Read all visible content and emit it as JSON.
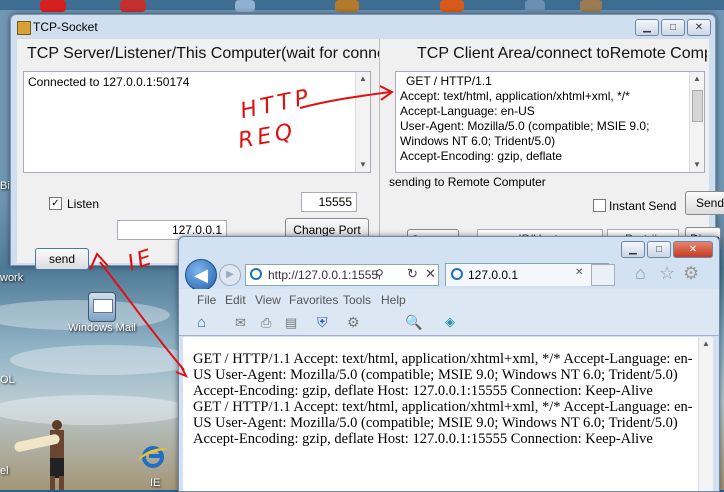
{
  "tcp_window": {
    "title": "TCP-Socket",
    "left_panel": {
      "heading": "TCP Server/Listener/This Computer(wait for connect re",
      "log_text": "Connected to 127.0.0.1:50174",
      "listen_label": "Listen",
      "listen_checked": true,
      "port_value": "15555",
      "ip_value": "127.0.0.1",
      "change_port_label": "Change Port",
      "send_label": "send"
    },
    "right_panel": {
      "heading": "TCP Client Area/connect toRemote Computer",
      "request_lines": [
        "GET / HTTP/1.1",
        "Accept: text/html, application/xhtml+xml, */*",
        "Accept-Language: en-US",
        "User-Agent: Mozilla/5.0 (compatible; MSIE 9.0;",
        "Windows NT 6.0; Trident/5.0)",
        "Accept-Encoding: gzip, deflate"
      ],
      "status_text": "sending to Remote Computer",
      "instant_send_label": "Instant Send",
      "send_partial_label": "Send",
      "connect_partial_label": "Connect",
      "ip_host_partial": "IP/Host",
      "port_partial": "Port #",
      "disconnect_partial_label": "Discon"
    }
  },
  "ie_window": {
    "address": "http://127.0.0.1:1555",
    "tab_title": "127.0.0.1",
    "menu": [
      "File",
      "Edit",
      "View",
      "Favorites",
      "Tools",
      "Help"
    ],
    "content_paragraphs": [
      "GET / HTTP/1.1 Accept: text/html, application/xhtml+xml, */* Accept-Language: en-US User-Agent: Mozilla/5.0 (compatible; MSIE 9.0; Windows NT 6.0; Trident/5.0) Accept-Encoding: gzip, deflate Host: 127.0.0.1:15555 Connection: Keep-Alive",
      "GET / HTTP/1.1 Accept: text/html, application/xhtml+xml, */* Accept-Language: en-US User-Agent: Mozilla/5.0 (compatible; MSIE 9.0; Windows NT 6.0; Trident/5.0) Accept-Encoding: gzip, deflate Host: 127.0.0.1:15555 Connection: Keep-Alive"
    ]
  },
  "desktop": {
    "icon_windows_mail": "Windows Mail",
    "icon_ie": "IE",
    "edge_labels": [
      "Bi",
      "work",
      "OL",
      "el"
    ]
  },
  "annotations": {
    "http_req_line1": "HTTP",
    "http_req_line2": "REQ",
    "ie_label": "IE"
  },
  "colors": {
    "annotation_red": "#e01010",
    "ie_blue": "#1f6fc4"
  }
}
